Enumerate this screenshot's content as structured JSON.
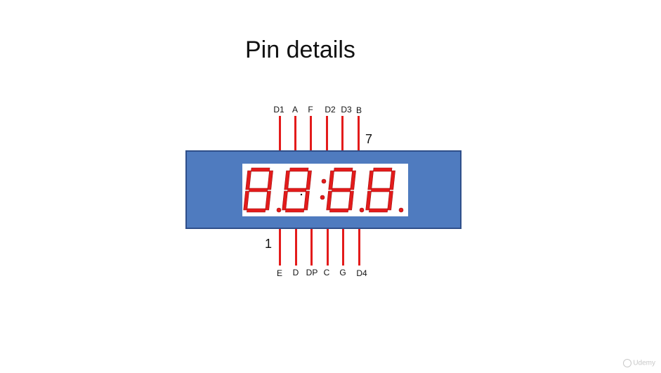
{
  "title": "Pin details",
  "top_pins": [
    "D1",
    "A",
    "F",
    "D2",
    "D3",
    "B"
  ],
  "bottom_pins": [
    "E",
    "D",
    "DP",
    "C",
    "G",
    "D4"
  ],
  "pin_number_first": "1",
  "pin_number_last": "7",
  "watermark": "Udemy",
  "colors": {
    "module": "#4f7bbf",
    "wire": "#e31b1b",
    "segment": "#e31b1b",
    "text": "#111111"
  }
}
